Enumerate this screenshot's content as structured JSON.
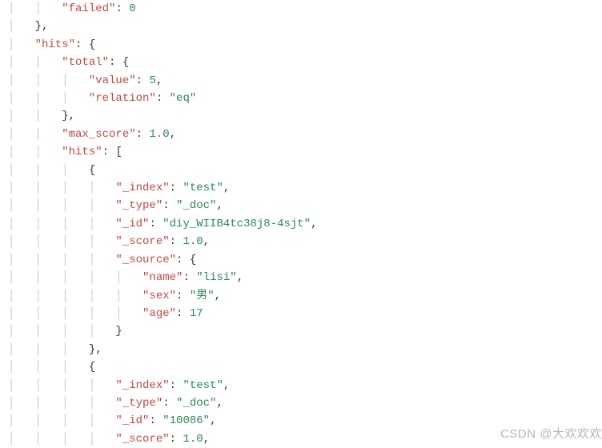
{
  "lines": [
    {
      "indent": 2,
      "tokens": [
        {
          "t": "key",
          "v": "\"failed\""
        },
        {
          "t": "punct",
          "v": ": "
        },
        {
          "t": "num",
          "v": "0"
        }
      ]
    },
    {
      "indent": 1,
      "tokens": [
        {
          "t": "punct",
          "v": "},"
        }
      ]
    },
    {
      "indent": 1,
      "tokens": [
        {
          "t": "key",
          "v": "\"hits\""
        },
        {
          "t": "punct",
          "v": ": {"
        }
      ]
    },
    {
      "indent": 2,
      "tokens": [
        {
          "t": "key",
          "v": "\"total\""
        },
        {
          "t": "punct",
          "v": ": {"
        }
      ]
    },
    {
      "indent": 3,
      "tokens": [
        {
          "t": "key",
          "v": "\"value\""
        },
        {
          "t": "punct",
          "v": ": "
        },
        {
          "t": "num",
          "v": "5"
        },
        {
          "t": "punct",
          "v": ","
        }
      ]
    },
    {
      "indent": 3,
      "tokens": [
        {
          "t": "key",
          "v": "\"relation\""
        },
        {
          "t": "punct",
          "v": ": "
        },
        {
          "t": "str",
          "v": "\"eq\""
        }
      ]
    },
    {
      "indent": 2,
      "tokens": [
        {
          "t": "punct",
          "v": "},"
        }
      ]
    },
    {
      "indent": 2,
      "tokens": [
        {
          "t": "key",
          "v": "\"max_score\""
        },
        {
          "t": "punct",
          "v": ": "
        },
        {
          "t": "num",
          "v": "1.0"
        },
        {
          "t": "punct",
          "v": ","
        }
      ]
    },
    {
      "indent": 2,
      "tokens": [
        {
          "t": "key",
          "v": "\"hits\""
        },
        {
          "t": "punct",
          "v": ": ["
        }
      ]
    },
    {
      "indent": 3,
      "tokens": [
        {
          "t": "punct",
          "v": "{"
        }
      ]
    },
    {
      "indent": 4,
      "tokens": [
        {
          "t": "key",
          "v": "\"_index\""
        },
        {
          "t": "punct",
          "v": ": "
        },
        {
          "t": "str",
          "v": "\"test\""
        },
        {
          "t": "punct",
          "v": ","
        }
      ]
    },
    {
      "indent": 4,
      "tokens": [
        {
          "t": "key",
          "v": "\"_type\""
        },
        {
          "t": "punct",
          "v": ": "
        },
        {
          "t": "str",
          "v": "\"_doc\""
        },
        {
          "t": "punct",
          "v": ","
        }
      ]
    },
    {
      "indent": 4,
      "tokens": [
        {
          "t": "key",
          "v": "\"_id\""
        },
        {
          "t": "punct",
          "v": ": "
        },
        {
          "t": "str",
          "v": "\"diy_WIIB4tc38j8-4sjt\""
        },
        {
          "t": "punct",
          "v": ","
        }
      ]
    },
    {
      "indent": 4,
      "tokens": [
        {
          "t": "key",
          "v": "\"_score\""
        },
        {
          "t": "punct",
          "v": ": "
        },
        {
          "t": "num",
          "v": "1.0"
        },
        {
          "t": "punct",
          "v": ","
        }
      ]
    },
    {
      "indent": 4,
      "tokens": [
        {
          "t": "key",
          "v": "\"_source\""
        },
        {
          "t": "punct",
          "v": ": {"
        }
      ]
    },
    {
      "indent": 5,
      "tokens": [
        {
          "t": "key",
          "v": "\"name\""
        },
        {
          "t": "punct",
          "v": ": "
        },
        {
          "t": "str",
          "v": "\"lisi\""
        },
        {
          "t": "punct",
          "v": ","
        }
      ]
    },
    {
      "indent": 5,
      "tokens": [
        {
          "t": "key",
          "v": "\"sex\""
        },
        {
          "t": "punct",
          "v": ": "
        },
        {
          "t": "str",
          "v": "\"男\""
        },
        {
          "t": "punct",
          "v": ","
        }
      ]
    },
    {
      "indent": 5,
      "tokens": [
        {
          "t": "key",
          "v": "\"age\""
        },
        {
          "t": "punct",
          "v": ": "
        },
        {
          "t": "num",
          "v": "17"
        }
      ]
    },
    {
      "indent": 4,
      "tokens": [
        {
          "t": "punct",
          "v": "}"
        }
      ]
    },
    {
      "indent": 3,
      "tokens": [
        {
          "t": "punct",
          "v": "},"
        }
      ]
    },
    {
      "indent": 3,
      "tokens": [
        {
          "t": "punct",
          "v": "{"
        }
      ]
    },
    {
      "indent": 4,
      "tokens": [
        {
          "t": "key",
          "v": "\"_index\""
        },
        {
          "t": "punct",
          "v": ": "
        },
        {
          "t": "str",
          "v": "\"test\""
        },
        {
          "t": "punct",
          "v": ","
        }
      ]
    },
    {
      "indent": 4,
      "tokens": [
        {
          "t": "key",
          "v": "\"_type\""
        },
        {
          "t": "punct",
          "v": ": "
        },
        {
          "t": "str",
          "v": "\"_doc\""
        },
        {
          "t": "punct",
          "v": ","
        }
      ]
    },
    {
      "indent": 4,
      "tokens": [
        {
          "t": "key",
          "v": "\"_id\""
        },
        {
          "t": "punct",
          "v": ": "
        },
        {
          "t": "str",
          "v": "\"10086\""
        },
        {
          "t": "punct",
          "v": ","
        }
      ]
    },
    {
      "indent": 4,
      "tokens": [
        {
          "t": "key",
          "v": "\"_score\""
        },
        {
          "t": "punct",
          "v": ": "
        },
        {
          "t": "num",
          "v": "1.0"
        },
        {
          "t": "punct",
          "v": ","
        }
      ]
    }
  ],
  "watermark": "CSDN @大欢欢欢"
}
